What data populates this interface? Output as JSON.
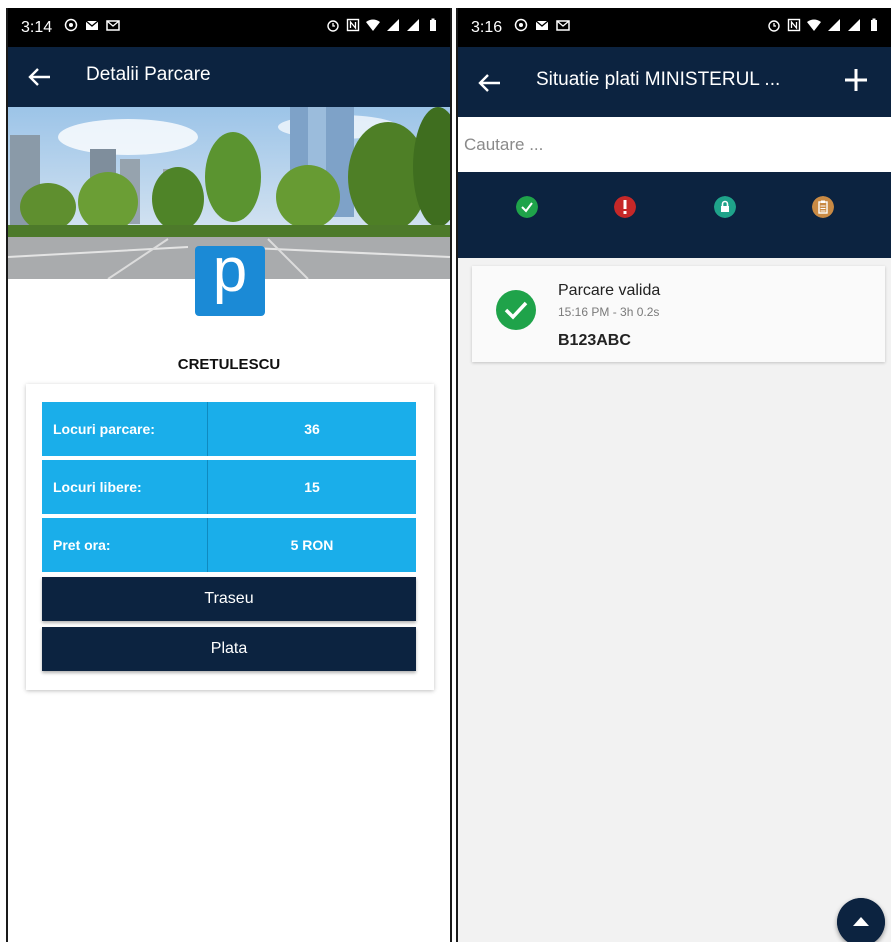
{
  "left_screen": {
    "status_time": "3:14",
    "title": "Detalii Parcare",
    "parking_name": "CRETULESCU",
    "logo_letter": "p",
    "rows": [
      {
        "label": "Locuri parcare:",
        "value": "36"
      },
      {
        "label": "Locuri libere:",
        "value": "15"
      },
      {
        "label": "Pret ora:",
        "value": "5 RON"
      }
    ],
    "buttons": {
      "route": "Traseu",
      "pay": "Plata"
    }
  },
  "right_screen": {
    "status_time": "3:16",
    "title": "Situatie plati MINISTERUL ...",
    "search_placeholder": "Cautare ...",
    "filters": [
      "check-filter-icon",
      "alert-filter-icon",
      "lock-filter-icon",
      "clipboard-filter-icon"
    ],
    "item": {
      "status": "Parcare valida",
      "time": "15:16 PM - 3h 0.2s",
      "plate": "B123ABC"
    }
  },
  "colors": {
    "header": "#0c2340",
    "info_row": "#1aaeea",
    "logo": "#1b8ad6",
    "valid_green": "#1fa34a",
    "alert_red": "#c62828",
    "lock_teal": "#1fa38a",
    "clipboard_tan": "#c98a44"
  }
}
